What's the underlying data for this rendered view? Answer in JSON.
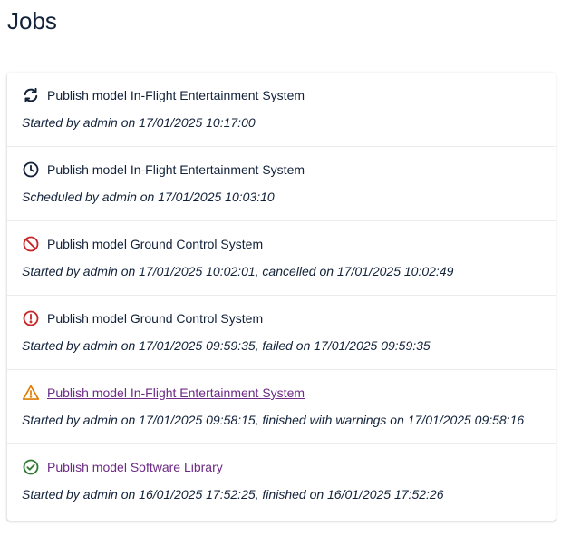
{
  "page": {
    "title": "Jobs"
  },
  "colors": {
    "running": "#12223a",
    "scheduled": "#12223a",
    "cancelled": "#c62828",
    "failed": "#c62828",
    "warning": "#e07b00",
    "success": "#2e7d32",
    "link": "#6d2a86"
  },
  "jobs": [
    {
      "status": "running",
      "icon": "sync-icon",
      "title": "Publish model In-Flight Entertainment System",
      "detail": "Started by admin on 17/01/2025 10:17:00",
      "is_link": false
    },
    {
      "status": "scheduled",
      "icon": "clock-icon",
      "title": "Publish model In-Flight Entertainment System",
      "detail": "Scheduled by admin on 17/01/2025 10:03:10",
      "is_link": false
    },
    {
      "status": "cancelled",
      "icon": "cancelled-icon",
      "title": "Publish model Ground Control System",
      "detail": "Started by admin on 17/01/2025 10:02:01, cancelled on 17/01/2025 10:02:49",
      "is_link": false
    },
    {
      "status": "failed",
      "icon": "error-icon",
      "title": "Publish model Ground Control System",
      "detail": "Started by admin on 17/01/2025 09:59:35, failed on 17/01/2025 09:59:35",
      "is_link": false
    },
    {
      "status": "warning",
      "icon": "warning-icon",
      "title": "Publish model In-Flight Entertainment System",
      "detail": "Started by admin on 17/01/2025 09:58:15, finished with warnings on 17/01/2025 09:58:16",
      "is_link": true
    },
    {
      "status": "success",
      "icon": "check-circle-icon",
      "title": "Publish model Software Library",
      "detail": "Started by admin on 16/01/2025 17:52:25, finished on 16/01/2025 17:52:26",
      "is_link": true
    }
  ]
}
